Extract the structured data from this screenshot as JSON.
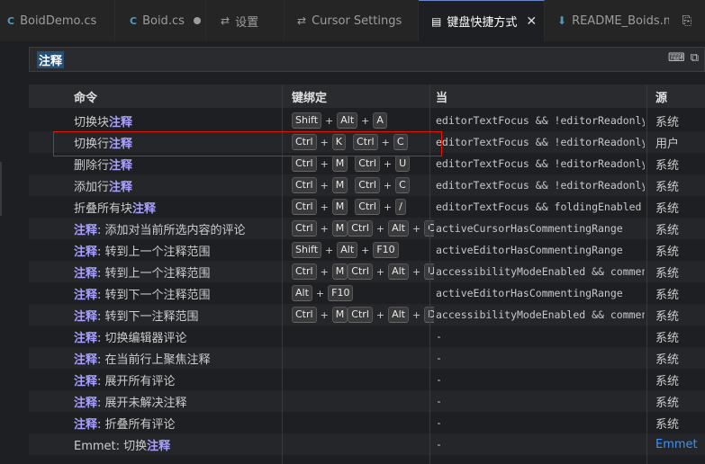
{
  "tabs": [
    {
      "label": "BoidDemo.cs",
      "icon": "csharp-file-icon",
      "glyph": "C"
    },
    {
      "label": "Boid.cs",
      "icon": "csharp-file-icon",
      "glyph": "C",
      "modified": true
    },
    {
      "label": "设置",
      "icon": "settings-icon",
      "glyph": "⇄"
    },
    {
      "label": "Cursor Settings",
      "icon": "settings-icon",
      "glyph": "⇄"
    },
    {
      "label": "键盘快捷方式",
      "icon": "keyboard-icon",
      "glyph": "▤",
      "active": true,
      "close": "✕"
    },
    {
      "label": "README_Boids.md",
      "icon": "markdown-file-icon",
      "glyph": "⬇"
    }
  ],
  "search": {
    "query": "注释"
  },
  "columns": {
    "command": "命令",
    "keybinding": "键绑定",
    "when": "当",
    "source": "源"
  },
  "rows": [
    {
      "pre": "切换块",
      "hl": "注释",
      "post": "",
      "keys": [
        [
          "Shift",
          "Alt",
          "A"
        ]
      ],
      "when": "editorTextFocus && !editorReadonly",
      "source": "系统"
    },
    {
      "pre": "切换行",
      "hl": "注释",
      "post": "",
      "keys": [
        [
          "Ctrl",
          "K"
        ],
        [
          "Ctrl",
          "C"
        ]
      ],
      "when": "editorTextFocus && !editorReadonly",
      "source": "用户"
    },
    {
      "pre": "删除行",
      "hl": "注释",
      "post": "",
      "keys": [
        [
          "Ctrl",
          "M"
        ],
        [
          "Ctrl",
          "U"
        ]
      ],
      "when": "editorTextFocus && !editorReadonly",
      "source": "系统"
    },
    {
      "pre": "添加行",
      "hl": "注释",
      "post": "",
      "keys": [
        [
          "Ctrl",
          "M"
        ],
        [
          "Ctrl",
          "C"
        ]
      ],
      "when": "editorTextFocus && !editorReadonly",
      "source": "系统"
    },
    {
      "pre": "折叠所有块",
      "hl": "注释",
      "post": "",
      "keys": [
        [
          "Ctrl",
          "M"
        ],
        [
          "Ctrl",
          "/"
        ]
      ],
      "when": "editorTextFocus && foldingEnabled",
      "source": "系统"
    },
    {
      "pre": "",
      "hl": "注释",
      "post": ": 添加对当前所选内容的评论",
      "keys": [
        [
          "Ctrl",
          "M"
        ],
        [
          "Ctrl",
          "Alt",
          "C"
        ]
      ],
      "when": "activeCursorHasCommentingRange",
      "source": "系统"
    },
    {
      "pre": "",
      "hl": "注释",
      "post": ": 转到上一个注释范围",
      "keys": [
        [
          "Shift",
          "Alt",
          "F10"
        ]
      ],
      "when": "activeEditorHasCommentingRange",
      "source": "系统"
    },
    {
      "pre": "",
      "hl": "注释",
      "post": ": 转到上一个注释范围",
      "keys": [
        [
          "Ctrl",
          "M"
        ],
        [
          "Ctrl",
          "Alt",
          "U"
        ]
      ],
      "when": "accessibilityModeEnabled && comment…",
      "source": "系统"
    },
    {
      "pre": "",
      "hl": "注释",
      "post": ": 转到下一个注释范围",
      "keys": [
        [
          "Alt",
          "F10"
        ]
      ],
      "when": "activeEditorHasCommentingRange",
      "source": "系统"
    },
    {
      "pre": "",
      "hl": "注释",
      "post": ": 转到下一注释范围",
      "keys": [
        [
          "Ctrl",
          "M"
        ],
        [
          "Ctrl",
          "Alt",
          "D"
        ]
      ],
      "when": "accessibilityModeEnabled && comment…",
      "source": "系统"
    },
    {
      "pre": "",
      "hl": "注释",
      "post": ": 切换编辑器评论",
      "keys": [],
      "when": "-",
      "source": "系统"
    },
    {
      "pre": "",
      "hl": "注释",
      "post": ": 在当前行上聚焦注释",
      "keys": [],
      "when": "-",
      "source": "系统"
    },
    {
      "pre": "",
      "hl": "注释",
      "post": ": 展开所有评论",
      "keys": [],
      "when": "-",
      "source": "系统"
    },
    {
      "pre": "",
      "hl": "注释",
      "post": ": 展开未解决注释",
      "keys": [],
      "when": "-",
      "source": "系统"
    },
    {
      "pre": "",
      "hl": "注释",
      "post": ": 折叠所有评论",
      "keys": [],
      "when": "-",
      "source": "系统"
    },
    {
      "pre": "Emmet: 切换",
      "hl": "注释",
      "post": "",
      "keys": [],
      "when": "-",
      "source": "Emmet",
      "sourceLink": true
    }
  ],
  "colors": {
    "highlight": "#a8a0ff",
    "redbox": "#e51400",
    "link": "#3794ff"
  }
}
